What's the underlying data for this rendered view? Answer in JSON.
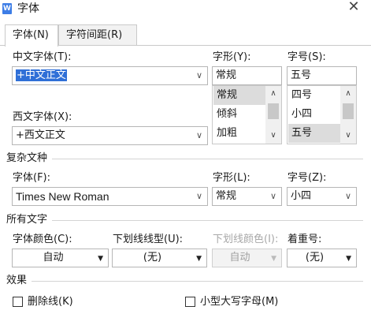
{
  "window": {
    "title": "字体",
    "app_icon": "W"
  },
  "tabs": [
    {
      "label": "字体(N)",
      "active": true
    },
    {
      "label": "字符间距(R)",
      "active": false
    }
  ],
  "chinese_font": {
    "label": "中文字体(T):",
    "value": "+中文正文"
  },
  "western_font": {
    "label": "西文字体(X):",
    "value": "+西文正文"
  },
  "style": {
    "label": "字形(Y):",
    "value": "常规",
    "options": [
      "常规",
      "倾斜",
      "加粗"
    ],
    "selected": "常规"
  },
  "size": {
    "label": "字号(S):",
    "value": "五号",
    "options": [
      "四号",
      "小四",
      "五号"
    ],
    "selected": "五号"
  },
  "complex_script": {
    "section": "复杂文种",
    "font_label": "字体(F):",
    "font_value": "Times New Roman",
    "style_label": "字形(L):",
    "style_value": "常规",
    "size_label": "字号(Z):",
    "size_value": "小四"
  },
  "all_text": {
    "section": "所有文字",
    "font_color_label": "字体颜色(C):",
    "font_color_value": "自动",
    "underline_type_label": "下划线线型(U):",
    "underline_type_value": "(无)",
    "underline_color_label": "下划线颜色(I):",
    "underline_color_value": "自动",
    "emphasis_label": "着重号:",
    "emphasis_value": "(无)"
  },
  "effects": {
    "section": "效果",
    "strikethrough": "删除线(K)",
    "small_caps": "小型大写字母(M)"
  }
}
